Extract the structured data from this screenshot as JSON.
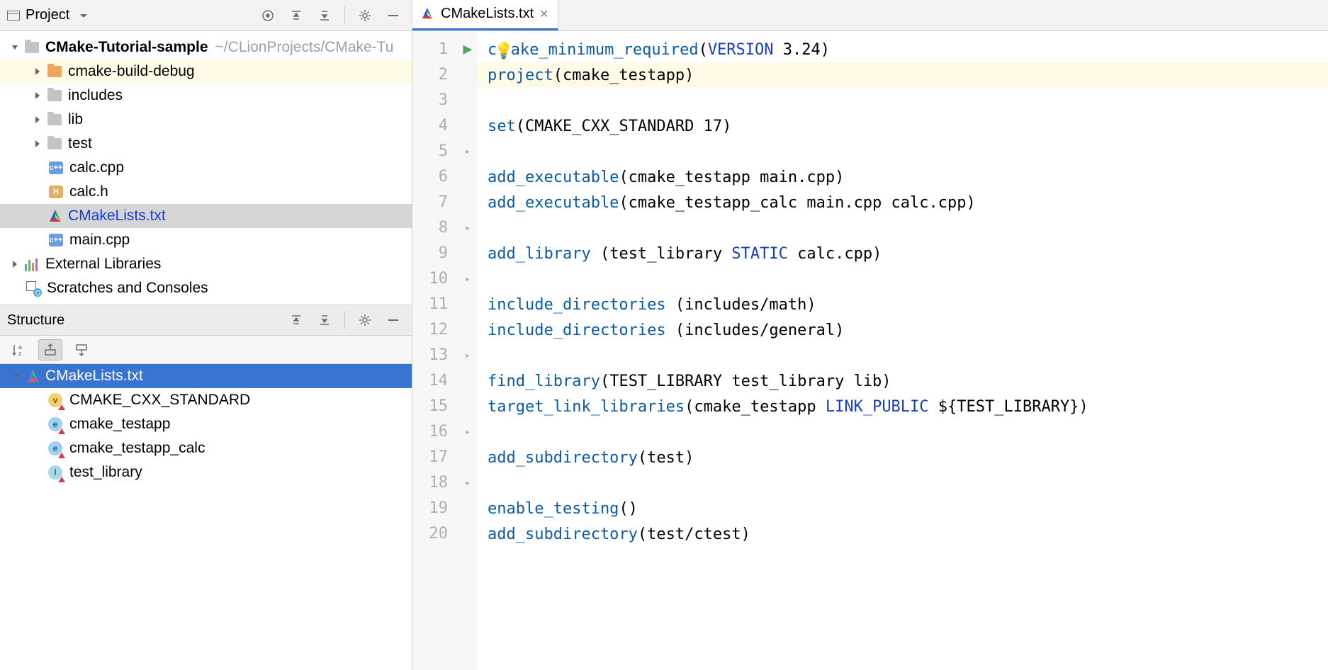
{
  "project_panel": {
    "title": "Project",
    "root": {
      "name": "CMake-Tutorial-sample",
      "path": "~/CLionProjects/CMake-Tu"
    },
    "tree": [
      {
        "name": "cmake-build-debug",
        "type": "folder-orange",
        "expandable": true
      },
      {
        "name": "includes",
        "type": "folder",
        "expandable": true
      },
      {
        "name": "lib",
        "type": "folder",
        "expandable": true
      },
      {
        "name": "test",
        "type": "folder",
        "expandable": true
      },
      {
        "name": "calc.cpp",
        "type": "cpp"
      },
      {
        "name": "calc.h",
        "type": "h"
      },
      {
        "name": "CMakeLists.txt",
        "type": "cmake",
        "selected": true
      },
      {
        "name": "main.cpp",
        "type": "cpp"
      }
    ],
    "external": "External Libraries",
    "scratches": "Scratches and Consoles"
  },
  "structure_panel": {
    "title": "Structure",
    "root": "CMakeLists.txt",
    "items": [
      {
        "label": "CMAKE_CXX_STANDARD",
        "kind": "v"
      },
      {
        "label": "cmake_testapp",
        "kind": "e"
      },
      {
        "label": "cmake_testapp_calc",
        "kind": "e"
      },
      {
        "label": "test_library",
        "kind": "l"
      }
    ]
  },
  "editor": {
    "tab_name": "CMakeLists.txt",
    "line_count": 20,
    "fold_lines": [
      5,
      8,
      10,
      13,
      16,
      18
    ],
    "code": {
      "l1a": "cmake_minimum_required",
      "l1b": "VERSION",
      "l1c": " 3.24)",
      "l2a": "project",
      "l2b": "(cmake_testapp)",
      "l4a": "set",
      "l4b": "(CMAKE_CXX_STANDARD 17)",
      "l6a": "add_executable",
      "l6b": "(cmake_testapp main.cpp)",
      "l7a": "add_executable",
      "l7b": "(cmake_testapp_calc main.cpp calc.cpp)",
      "l9a": "add_library",
      "l9b": " (test_library ",
      "l9c": "STATIC",
      "l9d": " calc.cpp)",
      "l11a": "include_directories",
      "l11b": " (includes/math)",
      "l12a": "include_directories",
      "l12b": " (includes/general)",
      "l14a": "find_library",
      "l14b": "(TEST_LIBRARY test_library lib)",
      "l15a": "target_link_libraries",
      "l15b": "(cmake_testapp ",
      "l15c": "LINK_PUBLIC",
      "l15d": " ${",
      "l15e": "TEST_LIBRARY",
      "l15f": "})",
      "l17a": "add_subdirectory",
      "l17b": "(test)",
      "l19a": "enable_testing",
      "l19b": "()",
      "l20a": "add_subdirectory",
      "l20b": "(test/ctest)"
    }
  }
}
